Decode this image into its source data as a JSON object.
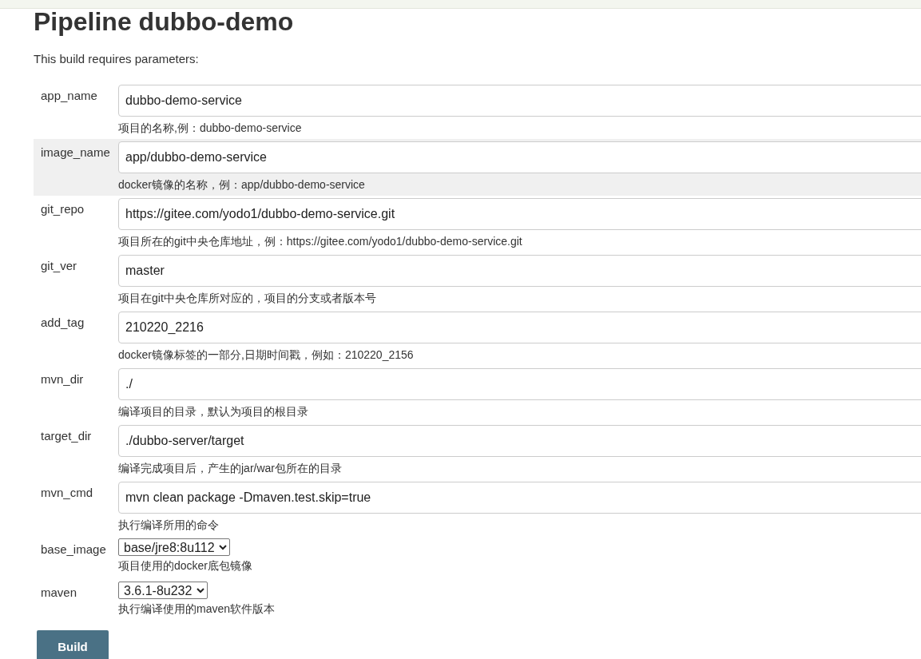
{
  "title": "Pipeline dubbo-demo",
  "intro": "This build requires parameters:",
  "parameters": [
    {
      "kind": "text",
      "name": "app_name",
      "value": "dubbo-demo-service",
      "description": "项目的名称,例：dubbo-demo-service",
      "highlighted": false
    },
    {
      "kind": "text",
      "name": "image_name",
      "value": "app/dubbo-demo-service",
      "description": "docker镜像的名称，例：app/dubbo-demo-service",
      "highlighted": true
    },
    {
      "kind": "text",
      "name": "git_repo",
      "value": "https://gitee.com/yodo1/dubbo-demo-service.git",
      "description": "项目所在的git中央仓库地址，例：https://gitee.com/yodo1/dubbo-demo-service.git",
      "highlighted": false
    },
    {
      "kind": "text",
      "name": "git_ver",
      "value": "master",
      "description": "项目在git中央仓库所对应的，项目的分支或者版本号",
      "highlighted": false
    },
    {
      "kind": "text",
      "name": "add_tag",
      "value": "210220_2216",
      "description": "docker镜像标签的一部分,日期时间戳，例如：210220_2156",
      "highlighted": false
    },
    {
      "kind": "text",
      "name": "mvn_dir",
      "value": "./",
      "description": "编译项目的目录，默认为项目的根目录",
      "highlighted": false
    },
    {
      "kind": "text",
      "name": "target_dir",
      "value": "./dubbo-server/target",
      "description": "编译完成项目后，产生的jar/war包所在的目录",
      "highlighted": false
    },
    {
      "kind": "text",
      "name": "mvn_cmd",
      "value": "mvn clean package -Dmaven.test.skip=true",
      "description": "执行编译所用的命令",
      "highlighted": false
    },
    {
      "kind": "select",
      "name": "base_image",
      "value": "base/jre8:8u112",
      "description": "项目使用的docker底包镜像",
      "highlighted": false
    },
    {
      "kind": "select",
      "name": "maven",
      "value": "3.6.1-8u232",
      "description": "执行编译使用的maven软件版本",
      "highlighted": false
    }
  ],
  "button": "Build"
}
